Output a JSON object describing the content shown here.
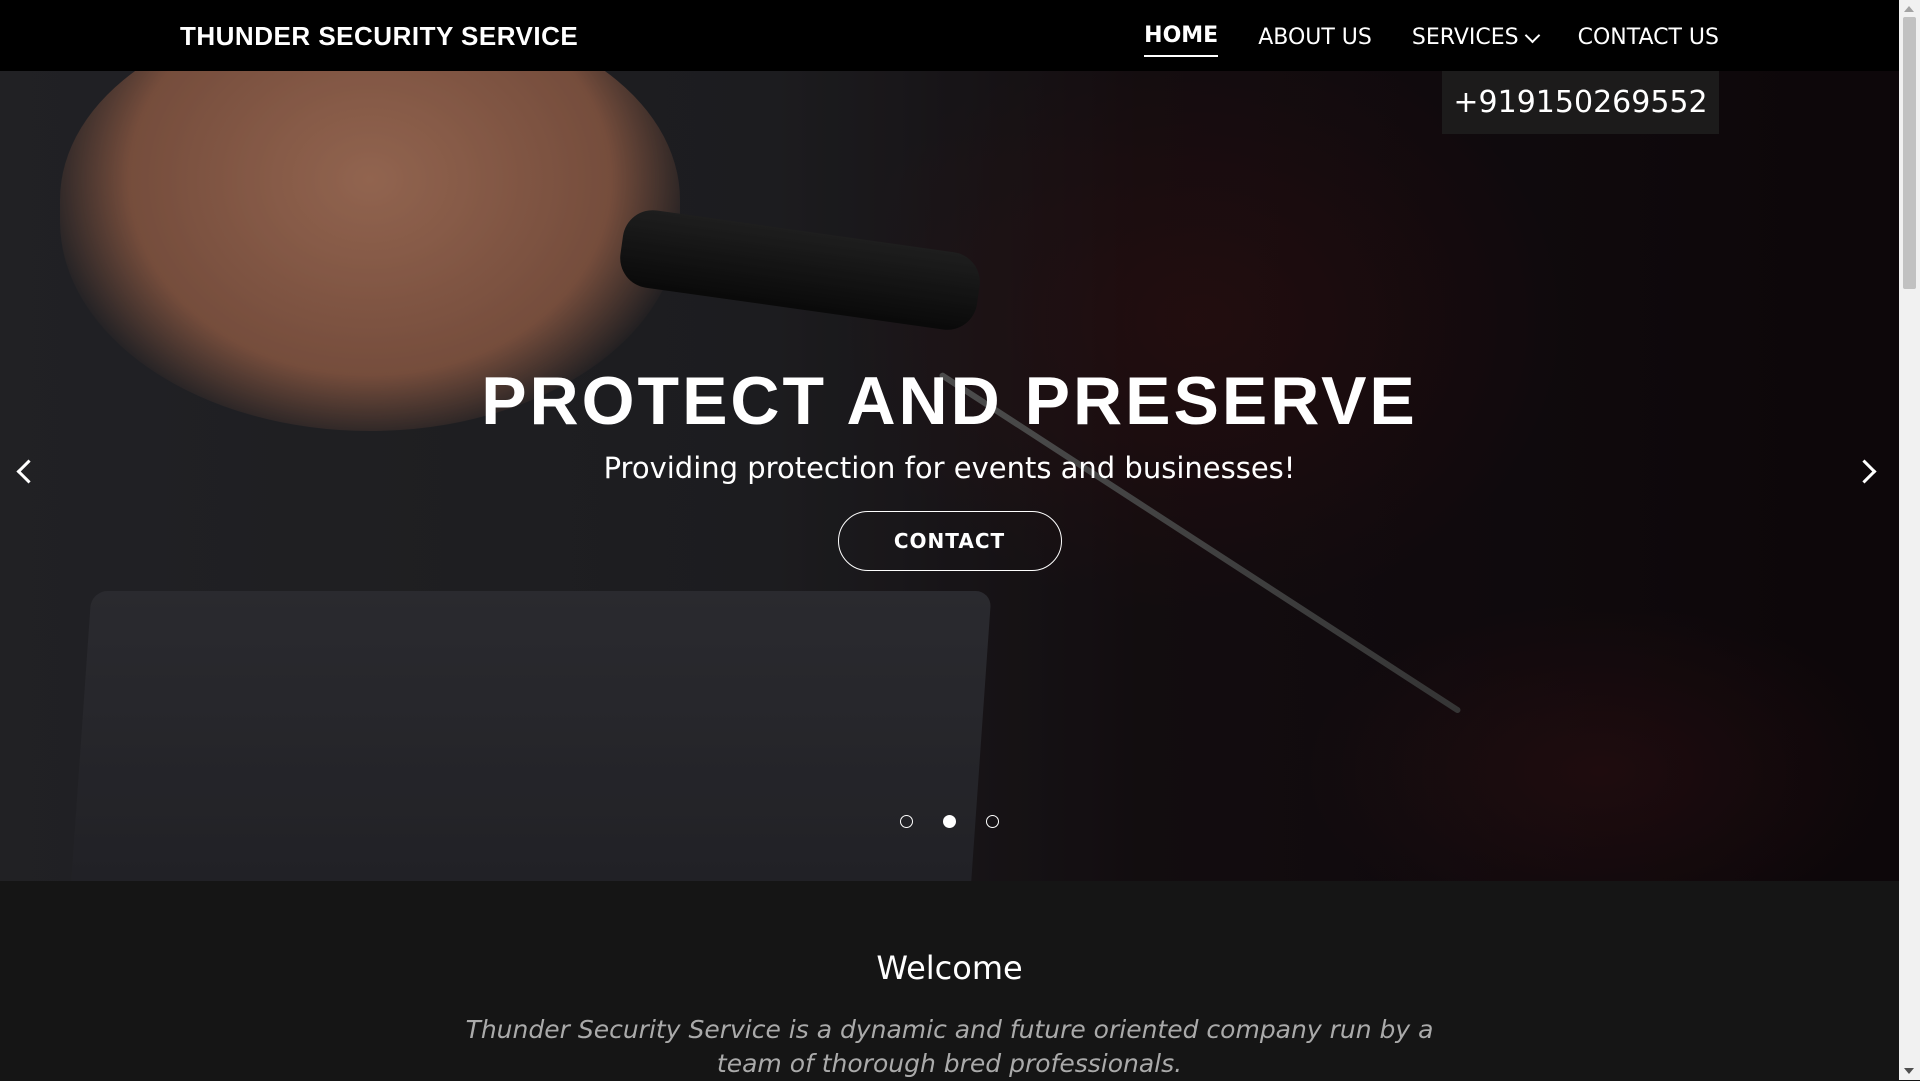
{
  "header": {
    "brand": "THUNDER SECURITY SERVICE",
    "nav": [
      {
        "label": "HOME",
        "active": true
      },
      {
        "label": "ABOUT US"
      },
      {
        "label": "SERVICES",
        "has_dropdown": true
      },
      {
        "label": "CONTACT US"
      }
    ]
  },
  "hero": {
    "phone": "+919150269552",
    "title": "PROTECT AND PRESERVE",
    "subtitle": "Providing protection for events and businesses!",
    "cta_label": "CONTACT",
    "slides": 3,
    "active_slide": 2
  },
  "welcome": {
    "heading": "Welcome",
    "text": "Thunder Security Service is a dynamic and future oriented company run by a team of thorough bred professionals."
  },
  "icons": {
    "prev": "chevron-left-icon",
    "next": "chevron-right-icon",
    "dropdown": "chevron-down-icon"
  }
}
